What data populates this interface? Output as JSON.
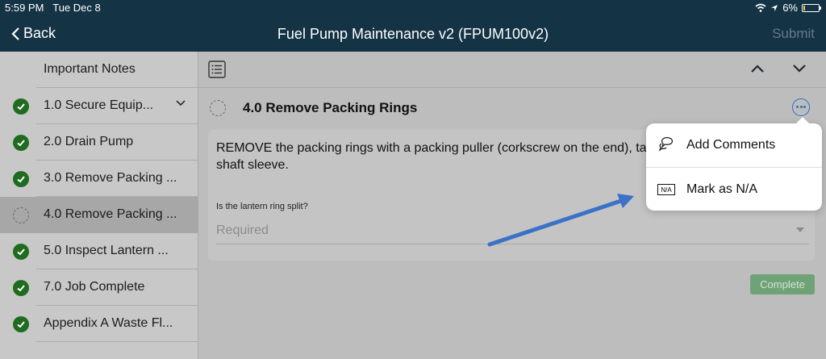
{
  "status_bar": {
    "time": "5:59 PM",
    "date": "Tue Dec 8",
    "battery": "6%"
  },
  "nav": {
    "back_label": "Back",
    "title": "Fuel Pump Maintenance v2 (FPUM100v2)",
    "submit_label": "Submit"
  },
  "sidebar": {
    "items": [
      {
        "label": "Important Notes",
        "state": "none"
      },
      {
        "label": "1.0 Secure Equip...",
        "state": "complete",
        "expandable": true
      },
      {
        "label": "2.0 Drain Pump",
        "state": "complete"
      },
      {
        "label": "3.0 Remove Packing ...",
        "state": "complete"
      },
      {
        "label": "4.0 Remove Packing ...",
        "state": "pending",
        "selected": true
      },
      {
        "label": "5.0 Inspect Lantern ...",
        "state": "complete"
      },
      {
        "label": "7.0 Job Complete",
        "state": "complete"
      },
      {
        "label": "Appendix A Waste Fl...",
        "state": "complete"
      }
    ]
  },
  "step": {
    "title": "4.0 Remove Packing Rings",
    "instruction": "REMOVE the packing rings with a packing puller (corkscrew on the end), taking care not to score the shaft sleeve.",
    "question_label": "Is the lantern ring split?",
    "question_placeholder": "Required",
    "complete_label": "Complete"
  },
  "menu": {
    "items": [
      {
        "label": "Add Comments",
        "icon": "comment-icon"
      },
      {
        "label": "Mark as N/A",
        "icon": "na-icon",
        "icon_text": "N/A"
      }
    ]
  },
  "colors": {
    "nav_bg": "#143345",
    "check_green": "#1f6b1f",
    "accent_blue": "#2f6fbf",
    "complete_btn": "#6fa377"
  }
}
